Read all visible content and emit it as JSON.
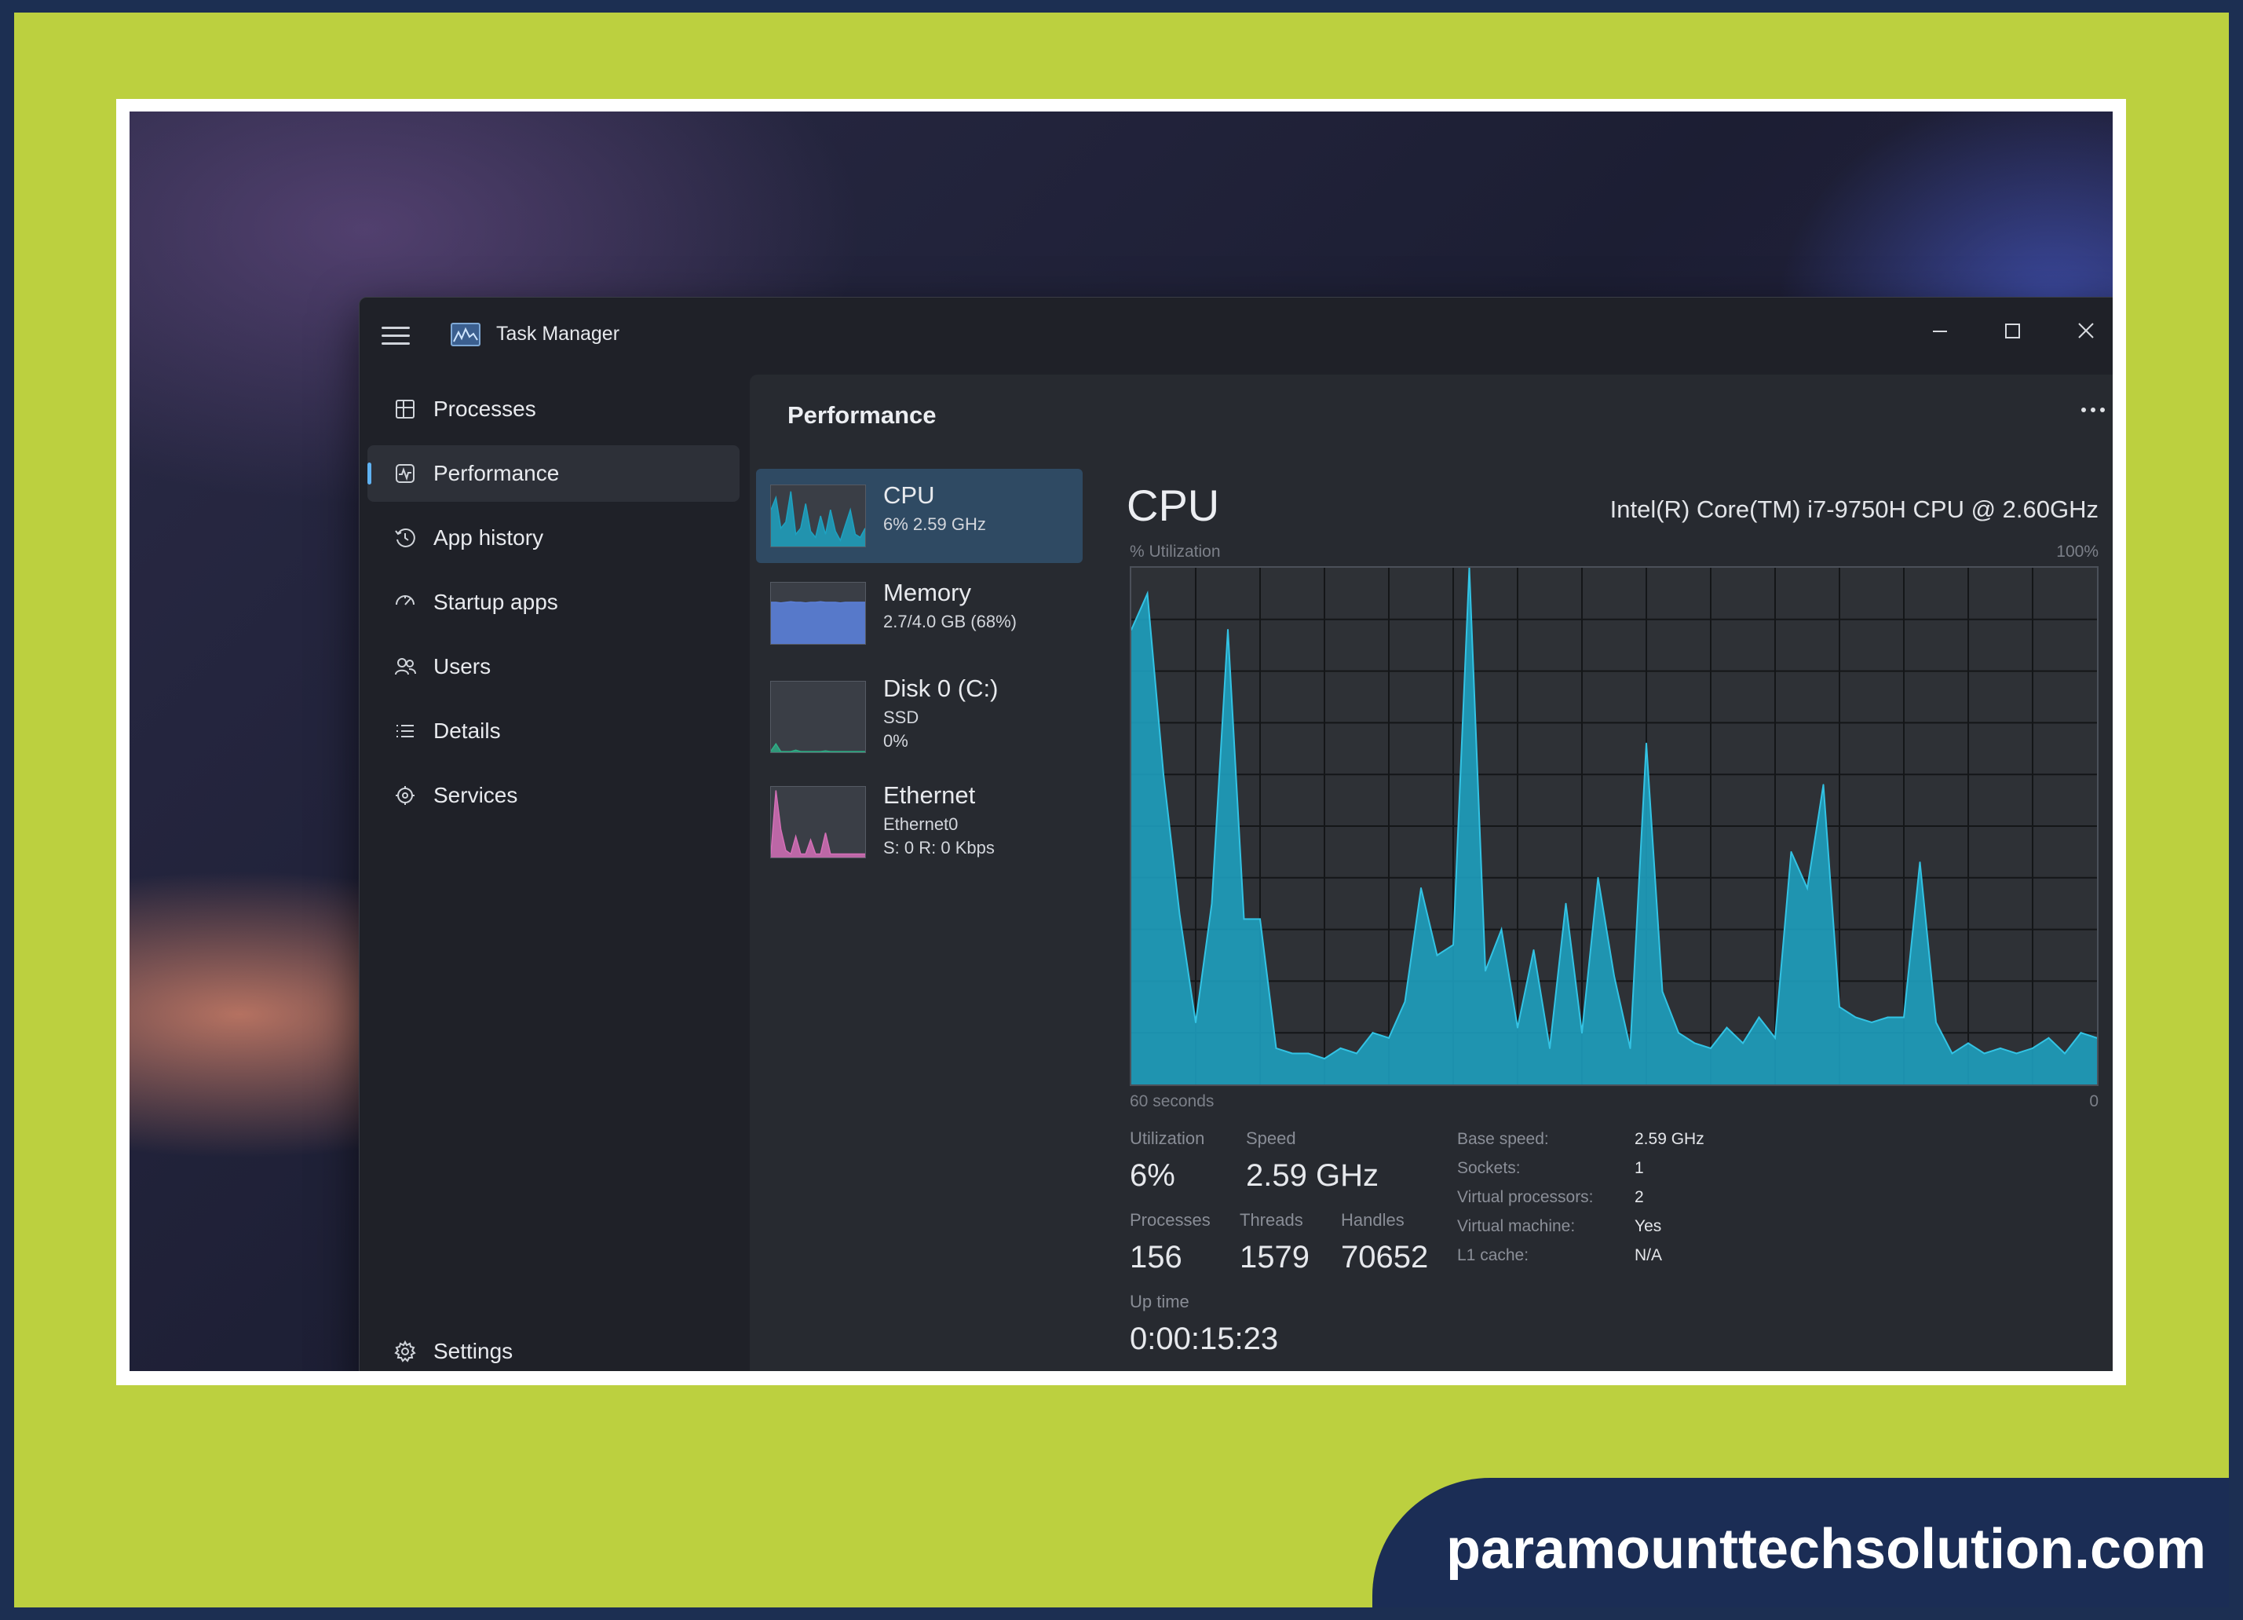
{
  "colors": {
    "accent": "#5fb2f2",
    "cpu_graph": "#1ea2c1",
    "memory_graph": "#5b7fd8",
    "ethernet_graph": "#d46fb7",
    "lime_border": "#bcd03f",
    "navy": "#1c2f52"
  },
  "window": {
    "title": "Task Manager",
    "controls": {
      "minimize_icon": "minimize-icon",
      "maximize_icon": "maximize-icon",
      "close_icon": "close-icon"
    }
  },
  "sidebar": {
    "items": [
      {
        "label": "Processes",
        "icon": "processes-icon"
      },
      {
        "label": "Performance",
        "icon": "performance-icon",
        "active": true
      },
      {
        "label": "App history",
        "icon": "history-icon"
      },
      {
        "label": "Startup apps",
        "icon": "startup-icon"
      },
      {
        "label": "Users",
        "icon": "users-icon"
      },
      {
        "label": "Details",
        "icon": "details-icon"
      },
      {
        "label": "Services",
        "icon": "services-icon"
      }
    ],
    "settings_label": "Settings"
  },
  "page": {
    "title": "Performance",
    "more_icon": "more-options-icon"
  },
  "devices": [
    {
      "name": "CPU",
      "line1": "6% 2.59 GHz",
      "selected": true
    },
    {
      "name": "Memory",
      "line1": "2.7/4.0 GB (68%)"
    },
    {
      "name": "Disk 0 (C:)",
      "line1": "SSD",
      "line2": "0%"
    },
    {
      "name": "Ethernet",
      "line1": "Ethernet0",
      "line2": "S: 0 R: 0 Kbps"
    }
  ],
  "detail": {
    "heading": "CPU",
    "model": "Intel(R) Core(TM) i7-9750H CPU @ 2.60GHz",
    "axis_top_left": "% Utilization",
    "axis_top_right": "100%",
    "axis_bottom_left": "60 seconds",
    "axis_bottom_right": "0",
    "stats": {
      "utilization_label": "Utilization",
      "utilization": "6%",
      "speed_label": "Speed",
      "speed": "2.59 GHz",
      "processes_label": "Processes",
      "processes": "156",
      "threads_label": "Threads",
      "threads": "1579",
      "handles_label": "Handles",
      "handles": "70652",
      "uptime_label": "Up time",
      "uptime": "0:00:15:23"
    },
    "specs": [
      {
        "key": "Base speed:",
        "value": "2.59 GHz"
      },
      {
        "key": "Sockets:",
        "value": "1"
      },
      {
        "key": "Virtual processors:",
        "value": "2"
      },
      {
        "key": "Virtual machine:",
        "value": "Yes"
      },
      {
        "key": "L1 cache:",
        "value": "N/A"
      }
    ]
  },
  "chart_data": {
    "type": "area",
    "x": [
      0,
      1,
      2,
      3,
      4,
      5,
      6,
      7,
      8,
      9,
      10,
      11,
      12,
      13,
      14,
      15,
      16,
      17,
      18,
      19,
      20,
      21,
      22,
      23,
      24,
      25,
      26,
      27,
      28,
      29,
      30,
      31,
      32,
      33,
      34,
      35,
      36,
      37,
      38,
      39,
      40,
      41,
      42,
      43,
      44,
      45,
      46,
      47,
      48,
      49,
      50,
      51,
      52,
      53,
      54,
      55,
      56,
      57,
      58,
      59,
      60
    ],
    "values": [
      88,
      95,
      60,
      33,
      12,
      35,
      88,
      32,
      32,
      7,
      6,
      6,
      5,
      7,
      6,
      10,
      9,
      16,
      38,
      25,
      27,
      100,
      22,
      30,
      11,
      26,
      7,
      35,
      10,
      40,
      21,
      7,
      66,
      18,
      10,
      8,
      7,
      11,
      8,
      13,
      9,
      45,
      38,
      58,
      15,
      13,
      12,
      13,
      13,
      43,
      12,
      6,
      8,
      6,
      7,
      6,
      7,
      9,
      6,
      10,
      9
    ],
    "xlabel": "60 seconds",
    "ylabel": "% Utilization",
    "ylim": [
      0,
      100
    ],
    "xlim": [
      0,
      60
    ],
    "grid": true
  },
  "thumb_series": {
    "cpu": [
      60,
      80,
      30,
      40,
      90,
      20,
      30,
      70,
      25,
      15,
      50,
      20,
      60,
      25,
      10,
      35,
      60,
      20,
      15,
      30
    ],
    "memory": [
      68,
      68,
      67,
      68,
      69,
      68,
      68,
      67,
      68,
      68,
      69,
      68,
      68,
      68,
      67,
      68,
      68,
      68,
      68,
      68
    ],
    "disk": [
      2,
      12,
      1,
      1,
      1,
      3,
      1,
      1,
      1,
      1,
      1,
      2,
      1,
      1,
      1,
      1,
      1,
      1,
      1,
      1
    ],
    "ethernet": [
      5,
      95,
      40,
      10,
      5,
      30,
      5,
      5,
      25,
      5,
      5,
      35,
      5,
      5,
      5,
      5,
      5,
      5,
      5,
      5
    ]
  },
  "branding": {
    "text": "paramounttechsolution.com"
  }
}
